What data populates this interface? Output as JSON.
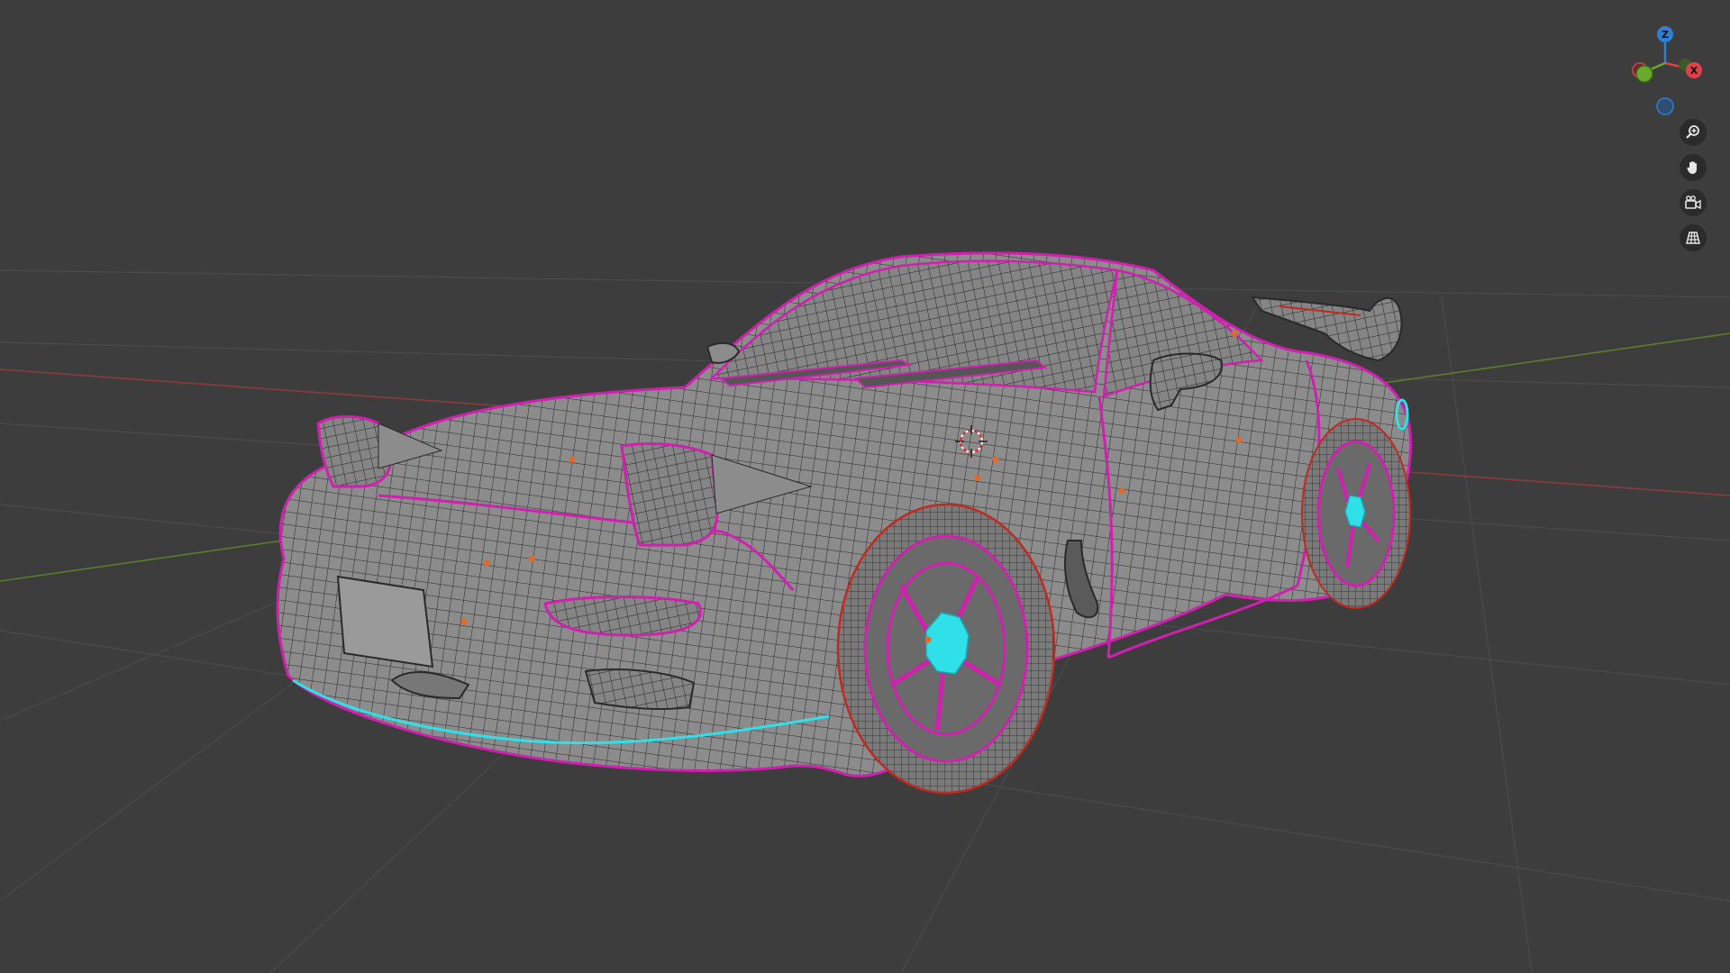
{
  "viewport": {
    "background_color": "#3d3d3d",
    "grid_color": "#4a4a4a",
    "x_axis_color": "#8a3b3b",
    "y_axis_color": "#5b7d2d",
    "object": "sports-car-wireframe",
    "mesh_color": "#8c8c8c",
    "wire_color": "#2a2a2a",
    "seam_color": "#d11fb0",
    "selection_color": "#2fe0e8",
    "origin_color": "#e06a2a"
  },
  "gizmo": {
    "z_label": "Z",
    "x_label": "X",
    "z_color": "#2f7fd6",
    "x_color": "#e0404a",
    "y_color": "#6aa82e"
  },
  "nav_tools": [
    {
      "icon": "zoom-icon"
    },
    {
      "icon": "hand-pan-icon"
    },
    {
      "icon": "camera-view-icon"
    },
    {
      "icon": "perspective-grid-icon"
    }
  ]
}
